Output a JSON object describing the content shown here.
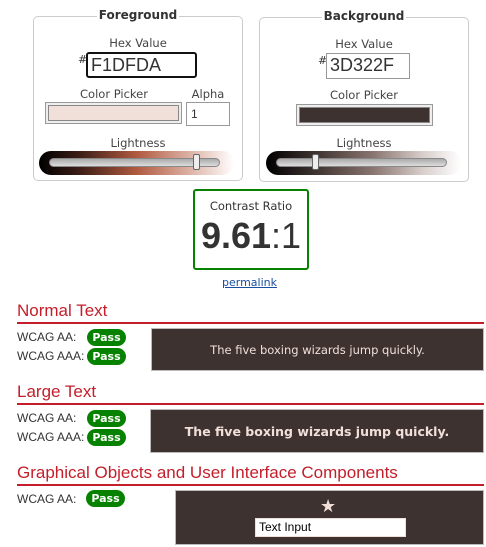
{
  "foreground": {
    "legend": "Foreground",
    "hex_label": "Hex Value",
    "hash": "#",
    "hex": "F1DFDA",
    "picker_label": "Color Picker",
    "alpha_label": "Alpha",
    "alpha": "1",
    "lightness_label": "Lightness",
    "color": "#F1DFDA",
    "lightness": 0.88
  },
  "background": {
    "legend": "Background",
    "hex_label": "Hex Value",
    "hash": "#",
    "hex": "3D322F",
    "picker_label": "Color Picker",
    "lightness_label": "Lightness",
    "color": "#3D322F",
    "lightness": 0.22
  },
  "contrast": {
    "label": "Contrast Ratio",
    "value": "9.61",
    "suffix": ":1",
    "permalink": "permalink"
  },
  "normal": {
    "title": "Normal Text",
    "aa": "WCAG AA:",
    "aaa": "WCAG AAA:",
    "aa_result": "Pass",
    "aaa_result": "Pass",
    "sample": "The five boxing wizards jump quickly."
  },
  "large": {
    "title": "Large Text",
    "aa": "WCAG AA:",
    "aaa": "WCAG AAA:",
    "aa_result": "Pass",
    "aaa_result": "Pass",
    "sample": "The five boxing wizards jump quickly."
  },
  "graphical": {
    "title": "Graphical Objects and User Interface Components",
    "aa": "WCAG AA:",
    "aa_result": "Pass",
    "star": "★",
    "input_value": "Text Input"
  }
}
